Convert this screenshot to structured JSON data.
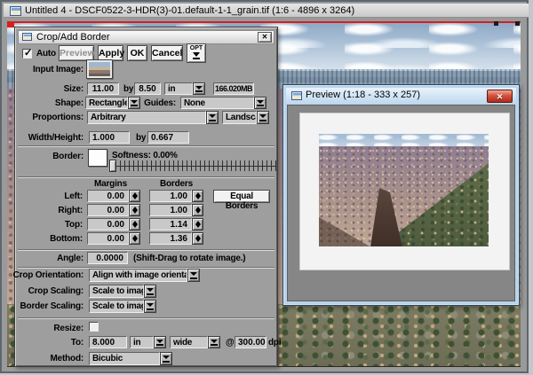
{
  "window": {
    "title": "Untitled 4 - DSCF0522-3-HDR(3)-01.default-1-1_grain.tif (1:6 - 4896 x 3264)"
  },
  "dialog": {
    "title": "Crop/Add Border",
    "close_label": "✕",
    "auto_label": "Auto",
    "auto_checked": true,
    "buttons": {
      "preview": "Preview",
      "apply": "Apply",
      "ok": "OK",
      "cancel": "Cancel",
      "opt": "OPT"
    },
    "input_image_label": "Input Image:",
    "size": {
      "label": "Size:",
      "width": "11.00",
      "by": "by",
      "height": "8.50",
      "units": "in",
      "filesize": "166.020MB"
    },
    "shape": {
      "label": "Shape:",
      "value": "Rectangle"
    },
    "guides": {
      "label": "Guides:",
      "value": "None"
    },
    "proportions": {
      "label": "Proportions:",
      "value": "Arbitrary",
      "orientation": "Landscape"
    },
    "width_height": {
      "label": "Width/Height:",
      "width": "1.000",
      "by": "by",
      "height": "0.667"
    },
    "border": {
      "label": "Border:",
      "softness": "Softness: 0.00%"
    },
    "margins": {
      "col1_header": "Margins",
      "col2_header": "Borders",
      "equal_borders_label": "Equal Borders",
      "rows": [
        {
          "label": "Left:",
          "margin": "0.00",
          "border": "1.00"
        },
        {
          "label": "Right:",
          "margin": "0.00",
          "border": "1.00"
        },
        {
          "label": "Top:",
          "margin": "0.00",
          "border": "1.14"
        },
        {
          "label": "Bottom:",
          "margin": "0.00",
          "border": "1.36"
        }
      ]
    },
    "angle": {
      "label": "Angle:",
      "value": "0.0000",
      "note": "(Shift-Drag to rotate image.)"
    },
    "crop_orientation": {
      "label": "Crop Orientation:",
      "value": "Align with image orientation"
    },
    "crop_scaling": {
      "label": "Crop Scaling:",
      "value": "Scale to image"
    },
    "border_scaling": {
      "label": "Border Scaling:",
      "value": "Scale to image"
    },
    "resize": {
      "label": "Resize:",
      "checked": false
    },
    "resize_to": {
      "label": "To:",
      "value": "8.000",
      "units": "in",
      "dimension": "wide",
      "at": "@",
      "resolution": "300.00",
      "resolution_units": "dpi"
    },
    "method": {
      "label": "Method:",
      "value": "Bicubic"
    }
  },
  "preview_window": {
    "title": "Preview (1:18 - 333 x 257)",
    "close_label": "✕"
  },
  "colors": {
    "dialog_bg": "#9e9e9e",
    "field_bg": "#c9c9c9",
    "crop_line": "#d42020",
    "preview_frame": "#b9d4ea",
    "close_button_red": "#b02d1f"
  }
}
